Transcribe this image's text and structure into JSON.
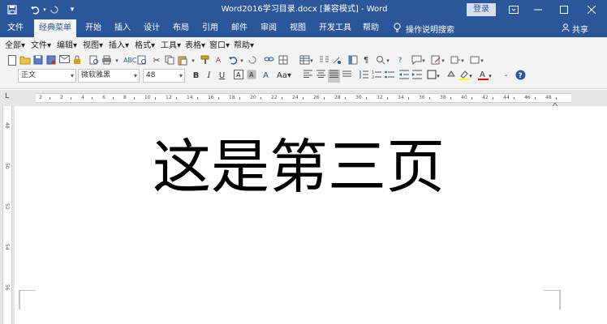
{
  "titlebar": {
    "title": "Word2016学习目录.docx [兼容模式] - Word",
    "signin": "登录",
    "save_icon": "save-icon",
    "undo_icon": "undo-icon",
    "redo_icon": "redo-icon",
    "customize_icon": "customize-qat-icon"
  },
  "tabs": [
    {
      "label": "文件"
    },
    {
      "label": "经典菜单"
    },
    {
      "label": "开始"
    },
    {
      "label": "插入"
    },
    {
      "label": "设计"
    },
    {
      "label": "布局"
    },
    {
      "label": "引用"
    },
    {
      "label": "邮件"
    },
    {
      "label": "审阅"
    },
    {
      "label": "视图"
    },
    {
      "label": "开发工具"
    },
    {
      "label": "帮助"
    }
  ],
  "tell_me": "操作说明搜索",
  "share": "共享",
  "menus": [
    "全部",
    "文件",
    "编辑",
    "视图",
    "插入",
    "格式",
    "工具",
    "表格",
    "窗口",
    "帮助"
  ],
  "format": {
    "style": "正文",
    "font": "微软雅黑",
    "size": "48",
    "bold": "B",
    "italic": "I",
    "underline": "U"
  },
  "ruler": {
    "h_numbers": [
      "2",
      "2",
      "4",
      "6",
      "8",
      "10",
      "12",
      "14",
      "16",
      "18",
      "20",
      "22",
      "24",
      "26",
      "28",
      "30",
      "32",
      "34",
      "36",
      "38",
      "40",
      "42",
      "44",
      "46",
      "48"
    ],
    "v_numbers": [
      "48",
      "50",
      "52",
      "54",
      "56"
    ]
  },
  "document": {
    "heading": "这是第三页"
  },
  "colors": {
    "accent": "#2b579a",
    "ribbon": "#f3f3f3",
    "canvas": "#e6e6e6",
    "highlight": "#ffff00",
    "font_color": "#ff0000"
  }
}
